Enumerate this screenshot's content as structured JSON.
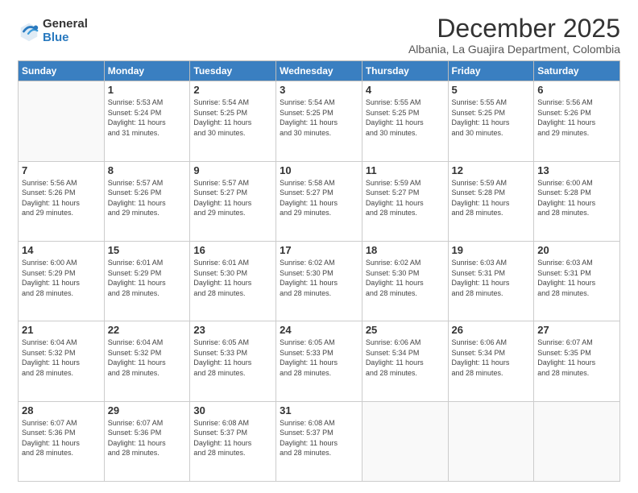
{
  "logo": {
    "general": "General",
    "blue": "Blue"
  },
  "title": "December 2025",
  "subtitle": "Albania, La Guajira Department, Colombia",
  "weekdays": [
    "Sunday",
    "Monday",
    "Tuesday",
    "Wednesday",
    "Thursday",
    "Friday",
    "Saturday"
  ],
  "weeks": [
    [
      {
        "day": "",
        "sunrise": "",
        "sunset": "",
        "daylight": ""
      },
      {
        "day": "1",
        "sunrise": "Sunrise: 5:53 AM",
        "sunset": "Sunset: 5:24 PM",
        "daylight": "Daylight: 11 hours and 31 minutes."
      },
      {
        "day": "2",
        "sunrise": "Sunrise: 5:54 AM",
        "sunset": "Sunset: 5:25 PM",
        "daylight": "Daylight: 11 hours and 30 minutes."
      },
      {
        "day": "3",
        "sunrise": "Sunrise: 5:54 AM",
        "sunset": "Sunset: 5:25 PM",
        "daylight": "Daylight: 11 hours and 30 minutes."
      },
      {
        "day": "4",
        "sunrise": "Sunrise: 5:55 AM",
        "sunset": "Sunset: 5:25 PM",
        "daylight": "Daylight: 11 hours and 30 minutes."
      },
      {
        "day": "5",
        "sunrise": "Sunrise: 5:55 AM",
        "sunset": "Sunset: 5:25 PM",
        "daylight": "Daylight: 11 hours and 30 minutes."
      },
      {
        "day": "6",
        "sunrise": "Sunrise: 5:56 AM",
        "sunset": "Sunset: 5:26 PM",
        "daylight": "Daylight: 11 hours and 29 minutes."
      }
    ],
    [
      {
        "day": "7",
        "sunrise": "Sunrise: 5:56 AM",
        "sunset": "Sunset: 5:26 PM",
        "daylight": "Daylight: 11 hours and 29 minutes."
      },
      {
        "day": "8",
        "sunrise": "Sunrise: 5:57 AM",
        "sunset": "Sunset: 5:26 PM",
        "daylight": "Daylight: 11 hours and 29 minutes."
      },
      {
        "day": "9",
        "sunrise": "Sunrise: 5:57 AM",
        "sunset": "Sunset: 5:27 PM",
        "daylight": "Daylight: 11 hours and 29 minutes."
      },
      {
        "day": "10",
        "sunrise": "Sunrise: 5:58 AM",
        "sunset": "Sunset: 5:27 PM",
        "daylight": "Daylight: 11 hours and 29 minutes."
      },
      {
        "day": "11",
        "sunrise": "Sunrise: 5:59 AM",
        "sunset": "Sunset: 5:27 PM",
        "daylight": "Daylight: 11 hours and 28 minutes."
      },
      {
        "day": "12",
        "sunrise": "Sunrise: 5:59 AM",
        "sunset": "Sunset: 5:28 PM",
        "daylight": "Daylight: 11 hours and 28 minutes."
      },
      {
        "day": "13",
        "sunrise": "Sunrise: 6:00 AM",
        "sunset": "Sunset: 5:28 PM",
        "daylight": "Daylight: 11 hours and 28 minutes."
      }
    ],
    [
      {
        "day": "14",
        "sunrise": "Sunrise: 6:00 AM",
        "sunset": "Sunset: 5:29 PM",
        "daylight": "Daylight: 11 hours and 28 minutes."
      },
      {
        "day": "15",
        "sunrise": "Sunrise: 6:01 AM",
        "sunset": "Sunset: 5:29 PM",
        "daylight": "Daylight: 11 hours and 28 minutes."
      },
      {
        "day": "16",
        "sunrise": "Sunrise: 6:01 AM",
        "sunset": "Sunset: 5:30 PM",
        "daylight": "Daylight: 11 hours and 28 minutes."
      },
      {
        "day": "17",
        "sunrise": "Sunrise: 6:02 AM",
        "sunset": "Sunset: 5:30 PM",
        "daylight": "Daylight: 11 hours and 28 minutes."
      },
      {
        "day": "18",
        "sunrise": "Sunrise: 6:02 AM",
        "sunset": "Sunset: 5:30 PM",
        "daylight": "Daylight: 11 hours and 28 minutes."
      },
      {
        "day": "19",
        "sunrise": "Sunrise: 6:03 AM",
        "sunset": "Sunset: 5:31 PM",
        "daylight": "Daylight: 11 hours and 28 minutes."
      },
      {
        "day": "20",
        "sunrise": "Sunrise: 6:03 AM",
        "sunset": "Sunset: 5:31 PM",
        "daylight": "Daylight: 11 hours and 28 minutes."
      }
    ],
    [
      {
        "day": "21",
        "sunrise": "Sunrise: 6:04 AM",
        "sunset": "Sunset: 5:32 PM",
        "daylight": "Daylight: 11 hours and 28 minutes."
      },
      {
        "day": "22",
        "sunrise": "Sunrise: 6:04 AM",
        "sunset": "Sunset: 5:32 PM",
        "daylight": "Daylight: 11 hours and 28 minutes."
      },
      {
        "day": "23",
        "sunrise": "Sunrise: 6:05 AM",
        "sunset": "Sunset: 5:33 PM",
        "daylight": "Daylight: 11 hours and 28 minutes."
      },
      {
        "day": "24",
        "sunrise": "Sunrise: 6:05 AM",
        "sunset": "Sunset: 5:33 PM",
        "daylight": "Daylight: 11 hours and 28 minutes."
      },
      {
        "day": "25",
        "sunrise": "Sunrise: 6:06 AM",
        "sunset": "Sunset: 5:34 PM",
        "daylight": "Daylight: 11 hours and 28 minutes."
      },
      {
        "day": "26",
        "sunrise": "Sunrise: 6:06 AM",
        "sunset": "Sunset: 5:34 PM",
        "daylight": "Daylight: 11 hours and 28 minutes."
      },
      {
        "day": "27",
        "sunrise": "Sunrise: 6:07 AM",
        "sunset": "Sunset: 5:35 PM",
        "daylight": "Daylight: 11 hours and 28 minutes."
      }
    ],
    [
      {
        "day": "28",
        "sunrise": "Sunrise: 6:07 AM",
        "sunset": "Sunset: 5:36 PM",
        "daylight": "Daylight: 11 hours and 28 minutes."
      },
      {
        "day": "29",
        "sunrise": "Sunrise: 6:07 AM",
        "sunset": "Sunset: 5:36 PM",
        "daylight": "Daylight: 11 hours and 28 minutes."
      },
      {
        "day": "30",
        "sunrise": "Sunrise: 6:08 AM",
        "sunset": "Sunset: 5:37 PM",
        "daylight": "Daylight: 11 hours and 28 minutes."
      },
      {
        "day": "31",
        "sunrise": "Sunrise: 6:08 AM",
        "sunset": "Sunset: 5:37 PM",
        "daylight": "Daylight: 11 hours and 28 minutes."
      },
      {
        "day": "",
        "sunrise": "",
        "sunset": "",
        "daylight": ""
      },
      {
        "day": "",
        "sunrise": "",
        "sunset": "",
        "daylight": ""
      },
      {
        "day": "",
        "sunrise": "",
        "sunset": "",
        "daylight": ""
      }
    ]
  ]
}
